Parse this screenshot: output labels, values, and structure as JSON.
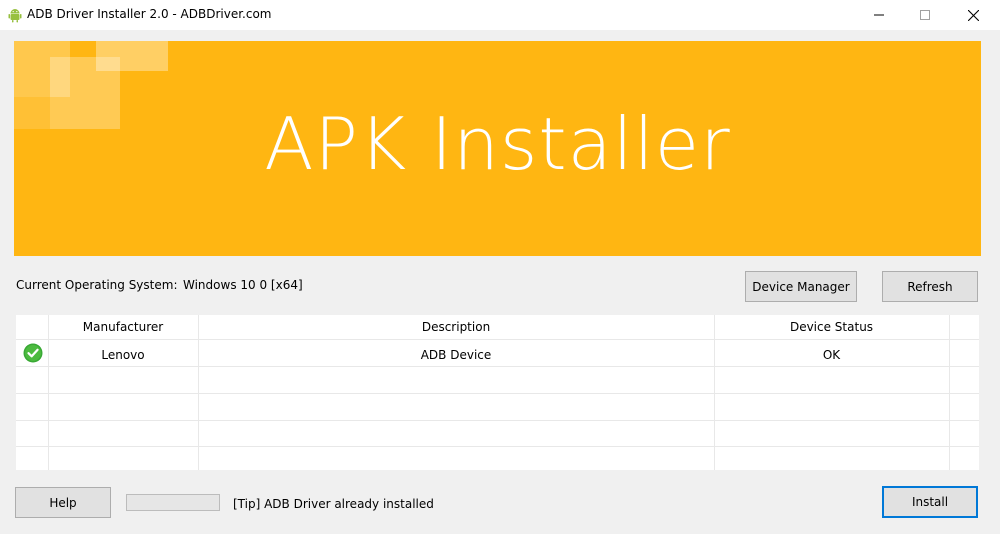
{
  "window": {
    "title": "ADB Driver Installer 2.0 - ADBDriver.com",
    "app_icon": "android-icon"
  },
  "banner": {
    "title": "APK Installer",
    "color": "#ffb612"
  },
  "system": {
    "label": "Current Operating System:",
    "value": "Windows 10 0 [x64]"
  },
  "buttons": {
    "device_manager": "Device Manager",
    "refresh": "Refresh",
    "help": "Help",
    "install": "Install"
  },
  "table": {
    "columns": [
      "Manufacturer",
      "Description",
      "Device Status"
    ],
    "rows": [
      {
        "status_icon": "check-circle-icon",
        "manufacturer": "Lenovo",
        "description": "ADB Device",
        "status": "OK"
      }
    ]
  },
  "progress": {
    "value": 0
  },
  "tip": "[Tip] ADB Driver already installed",
  "colors": {
    "accent": "#0078d7",
    "ok": "#39a935"
  }
}
